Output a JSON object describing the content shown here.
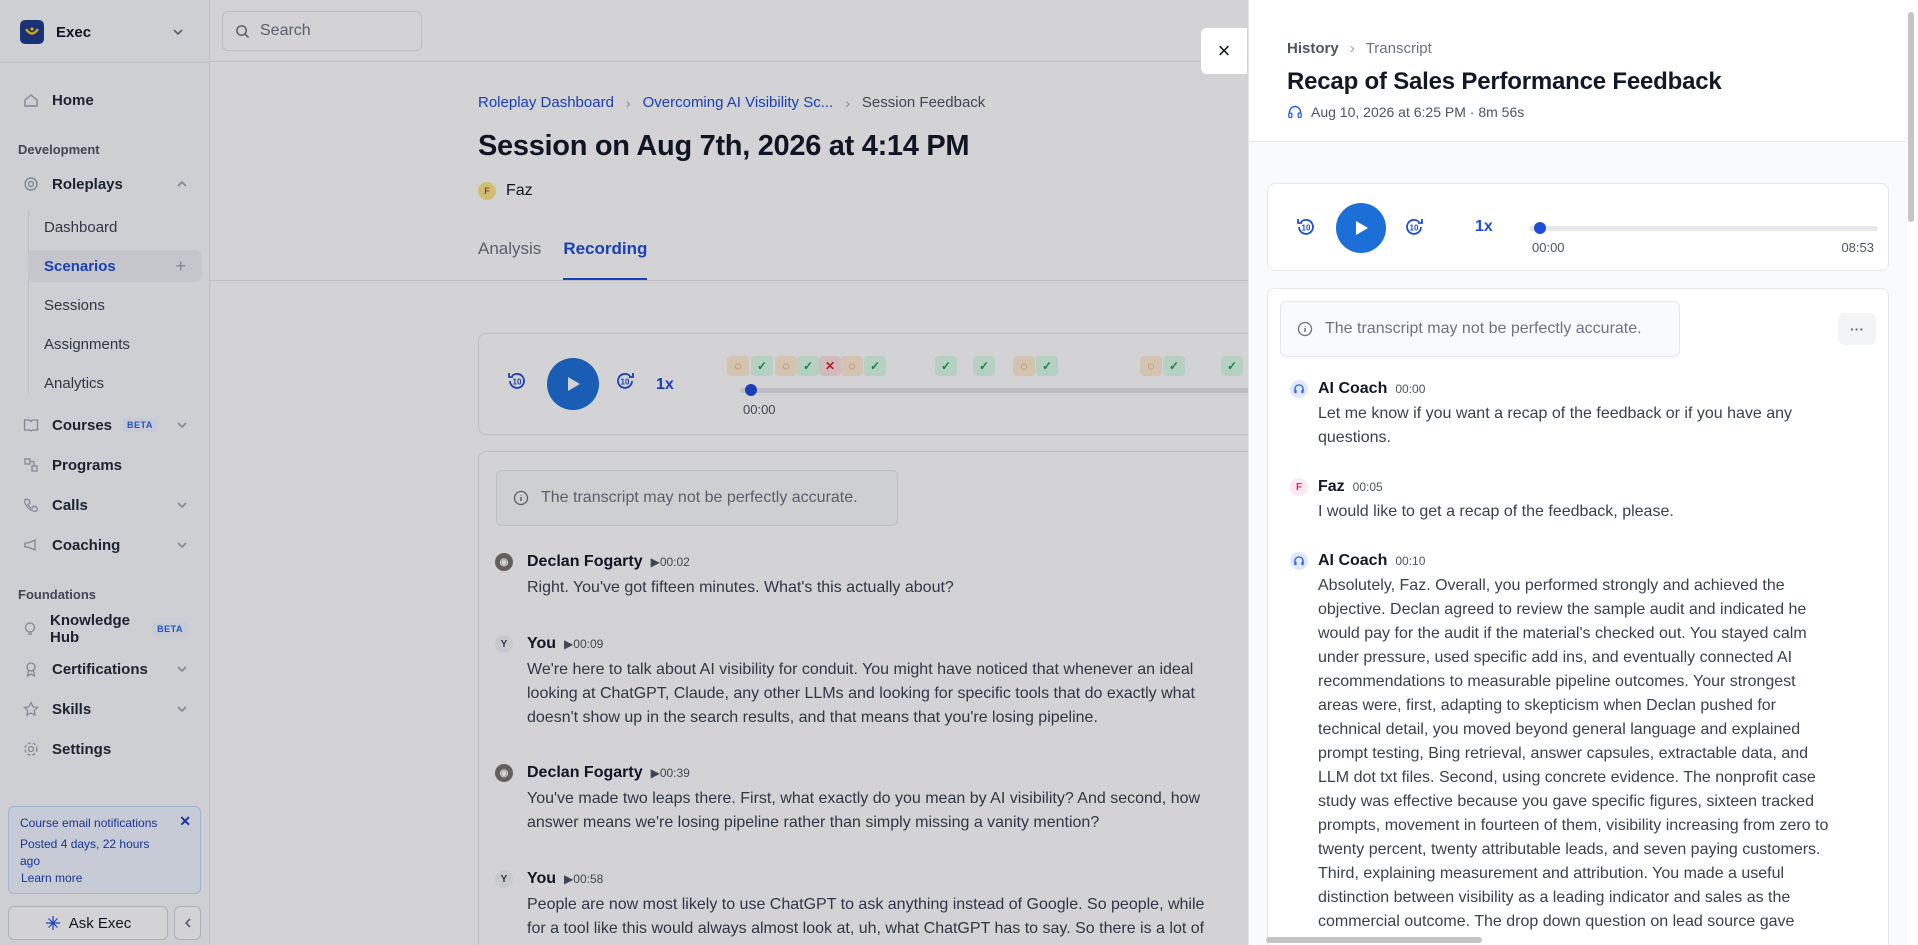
{
  "workspace": {
    "name": "Exec"
  },
  "topbar": {
    "search_placeholder": "Search"
  },
  "sidebar": {
    "home": "Home",
    "section_development": "Development",
    "roleplays": "Roleplays",
    "sub_items": {
      "dashboard": "Dashboard",
      "scenarios": "Scenarios",
      "sessions": "Sessions",
      "assignments": "Assignments",
      "analytics": "Analytics"
    },
    "courses": "Courses",
    "beta": "BETA",
    "programs": "Programs",
    "calls": "Calls",
    "coaching": "Coaching",
    "section_foundations": "Foundations",
    "knowledge_hub": "Knowledge Hub",
    "certifications": "Certifications",
    "skills": "Skills",
    "settings": "Settings",
    "notification": {
      "title": "Course email notifications",
      "posted": "Posted 4 days, 22 hours ago",
      "link": "Learn more"
    },
    "ask_exec": "Ask Exec"
  },
  "main": {
    "breadcrumb": [
      "Roleplay Dashboard",
      "Overcoming AI Visibility Sc...",
      "Session Feedback"
    ],
    "title": "Session on Aug 7th, 2026 at 4:14 PM",
    "user": {
      "initial": "F",
      "name": "Faz"
    },
    "tabs": [
      "Analysis",
      "Recording"
    ],
    "active_tab": "Recording",
    "player": {
      "rate": "1x",
      "time": "00:00",
      "progress": 0
    },
    "disclaimer": "The transcript may not be perfectly accurate.",
    "messages": [
      {
        "speaker": "Declan Fogarty",
        "time": "00:02",
        "text": "Right. You've got fifteen minutes. What's this actually about?"
      },
      {
        "speaker": "You",
        "initial": "Y",
        "time": "00:09",
        "lines": [
          "We're here to talk about AI visibility for conduit. You might have noticed that whenever an ideal",
          "looking at ChatGPT, Claude, any other LLMs and looking for specific tools that do exactly what",
          "doesn't show up in the search results, and that means that you're losing pipeline."
        ]
      },
      {
        "speaker": "Declan Fogarty",
        "time": "00:39",
        "lines": [
          "You've made two leaps there. First, what exactly do you mean by AI visibility? And second, how",
          "answer means we're losing pipeline rather than simply missing a vanity mention?"
        ]
      },
      {
        "speaker": "You",
        "initial": "Y",
        "time": "00:58",
        "lines": [
          "People are now most likely to use ChatGPT to ask anything instead of Google. So people, while",
          "for a tool like this would always almost look at, uh, what ChatGPT has to say. So there is a lot of"
        ]
      }
    ]
  },
  "drawer": {
    "close": "×",
    "breadcrumb": [
      "History",
      "Transcript"
    ],
    "title": "Recap of Sales Performance Feedback",
    "meta": "Aug 10, 2026 at 6:25 PM · 8m 56s",
    "player": {
      "rate": "1x",
      "current": "00:00",
      "duration": "08:53",
      "progress": 0
    },
    "disclaimer": "The transcript may not be perfectly accurate.",
    "more": "···",
    "messages": [
      {
        "speaker": "AI Coach",
        "time": "00:00",
        "lines": [
          "Let me know if you want a recap of the feedback or if you have any",
          "questions."
        ]
      },
      {
        "speaker": "Faz",
        "initial": "F",
        "time": "00:05",
        "lines": [
          "I would like to get a recap of the feedback, please."
        ]
      },
      {
        "speaker": "AI Coach",
        "time": "00:10",
        "lines": [
          "Absolutely, Faz. Overall, you performed strongly and achieved the",
          "objective. Declan agreed to review the sample audit and indicated he",
          "would pay for the audit if the material's checked out. You stayed calm",
          "under pressure, used specific add ins, and eventually connected AI",
          "recommendations to measurable pipeline outcomes. Your strongest",
          "areas were, first, adapting to skepticism when Declan pushed for",
          "technical detail, you moved beyond general language and explained",
          "prompt testing, Bing retrieval, answer capsules, extractable data, and",
          "LLM dot txt files. Second, using concrete evidence. The nonprofit case",
          "study was effective because you gave specific figures, sixteen tracked",
          "prompts, movement in fourteen of them, visibility increasing from zero to",
          "twenty percent, twenty attributable leads, and seven paying customers.",
          "Third, explaining measurement and attribution. You made a useful",
          "distinction between visibility as a leading indicator and sales as the",
          "commercial outcome. The drop down question on lead source gave"
        ]
      }
    ]
  },
  "colors": {
    "accent": "#1d4ed8",
    "play": "#1d6fd8",
    "check_bg": "#dcfce7",
    "warn_bg": "#ffedd5",
    "error_bg": "#fee2e2"
  }
}
